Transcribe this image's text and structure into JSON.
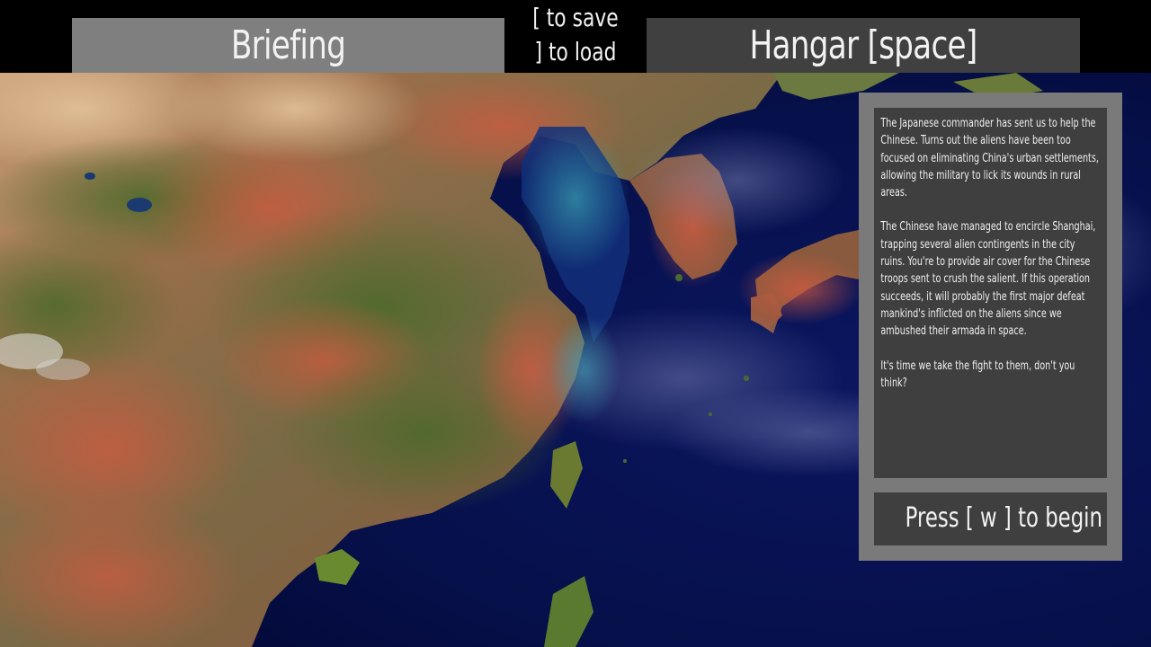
{
  "topbar": {
    "briefing_tab": "Briefing",
    "save_hint": "[ to save",
    "load_hint": "] to load",
    "hangar_tab": "Hangar [space]"
  },
  "briefing": {
    "paragraphs": [
      "The Japanese commander has sent us to help the Chinese. Turns out the aliens have been too focused on eliminating China's urban settlements, allowing the military to lick its wounds in rural areas.",
      "The Chinese have managed to encircle Shanghai, trapping several alien contingents in the city ruins. You're to provide air cover for the Chinese troops sent to crush the salient. If this operation succeeds, it will probably the first major defeat mankind's inflicted on the aliens since we ambushed their armada in space.",
      "It's time we take the fight to them, don't you think?"
    ],
    "begin_label": "Press [ w ] to begin"
  },
  "colors": {
    "topbar_bg": "#000000",
    "briefing_tab_bg": "#7f7f7f",
    "hangar_tab_bg": "#404040",
    "panel_frame": "#7a7a7a",
    "panel_inner": "#3f3f3f",
    "text": "#f2f2f2",
    "ocean": "#050a3e"
  },
  "map": {
    "region": "East Asia satellite map",
    "icon": "world-map"
  }
}
